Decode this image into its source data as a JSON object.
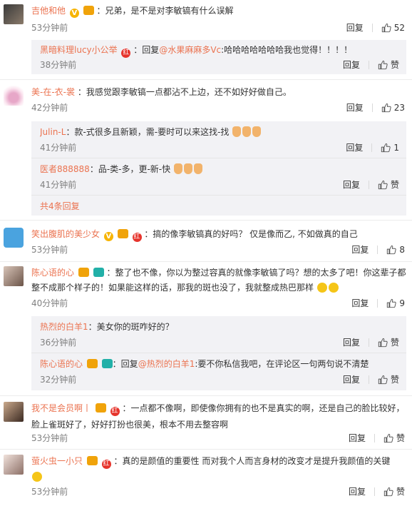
{
  "labels": {
    "reply": "回复",
    "like": "赞"
  },
  "comments": [
    {
      "user": "吉他和他",
      "text": "：兄弟，是不是对李敏镐有什么误解",
      "time": "53分钟前",
      "likes": "52",
      "replies": [
        {
          "user": "黑暗料理lucy小公举",
          "text": "：回复",
          "mention": "@水果麻麻多Vc",
          "rest": ":哈哈哈哈哈哈哈我也觉得！！！！",
          "time": "38分钟前",
          "likes": "赞"
        }
      ]
    },
    {
      "user": "美-在-衣-裳",
      "text": "：我感觉跟李敏镐一点都沾不上边，还不如好好做自己。",
      "time": "42分钟前",
      "likes": "23",
      "replies": [
        {
          "user": "Julin-L",
          "text": "：款-式很多且新颖，需-要时可以来这找-找",
          "time": "41分钟前",
          "likes": "1"
        },
        {
          "user": "医者888888",
          "text": "：品-类-多，更-新-快",
          "time": "41分钟前",
          "likes": "赞"
        }
      ],
      "more": "共4条回复"
    },
    {
      "user": "笑出腹肌的美少女",
      "text": "：搞的像李敏镐真的好吗？ 仅是像而乙, 不如做真的自己",
      "time": "53分钟前",
      "likes": "8"
    },
    {
      "user": "陈心语的心",
      "text": "：整了也不像，你以为整过容真的就像李敏镐了吗？想的太多了吧！你这辈子都",
      "text2": "整不成那个样子的！如果能这样的话，那我的斑也没了，我就整成热巴那样",
      "time": "40分钟前",
      "likes": "9",
      "replies": [
        {
          "user": "热烈的白羊1",
          "text": "：美女你的斑咋好的？",
          "time": "36分钟前",
          "likes": "赞"
        },
        {
          "user": "陈心语的心",
          "text": "：回复",
          "mention": "@热烈的白羊1",
          "rest": ":要不你私信我吧，在评论区一句两句说不清楚",
          "time": "32分钟前",
          "likes": "赞"
        }
      ]
    },
    {
      "user": "我不是会员啊丨",
      "text": "：一点都不像啊，即使像你拥有的也不是真实的啊，还是自己的脸比较好，",
      "text2": "脸上雀斑好了，好好打扮也很美，根本不用去整容啊",
      "time": "53分钟前",
      "likes": "赞"
    },
    {
      "user": "萤火虫一小只",
      "text": "：真的是颜值的重要性  而对我个人而言身材的改变才是提升我颜值的关键",
      "time": "53分钟前",
      "likes": "赞"
    }
  ],
  "colors": {
    "name": "#eb7350",
    "time": "#808080",
    "subbg": "#f2f2f5"
  }
}
